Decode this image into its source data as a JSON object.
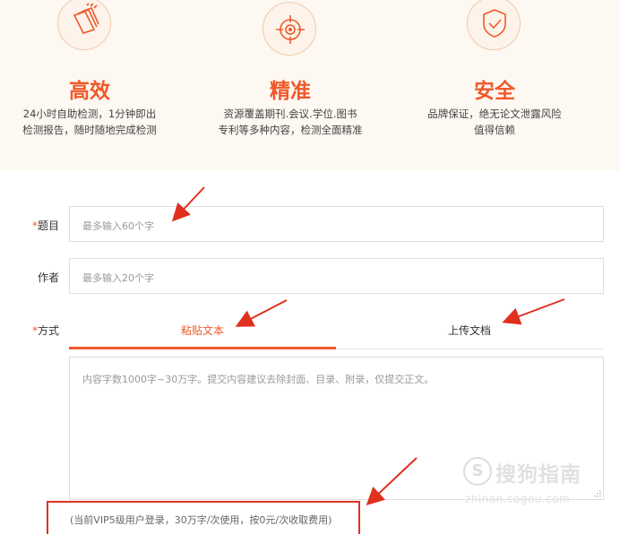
{
  "features": [
    {
      "icon": "document-stack-icon",
      "title": "高效",
      "desc1": "24小时自助检测，1分钟即出",
      "desc2": "检测报告，随时随地完成检测"
    },
    {
      "icon": "crosshair-target-icon",
      "title": "精准",
      "desc1": "资源覆盖期刊.会议.学位.图书",
      "desc2": "专利等多种内容，检测全面精准"
    },
    {
      "icon": "shield-check-icon",
      "title": "安全",
      "desc1": "品牌保证，绝无论文泄露风险",
      "desc2": "值得信赖"
    }
  ],
  "form": {
    "title_field": {
      "required_mark": "*",
      "label": "题目",
      "placeholder": "最多输入60个字"
    },
    "author_field": {
      "label": "作者",
      "placeholder": "最多输入20个字"
    },
    "method_field": {
      "required_mark": "*",
      "label": "方式"
    },
    "tabs": [
      {
        "label": "粘贴文本",
        "active": true
      },
      {
        "label": "上传文档",
        "active": false
      }
    ],
    "content_placeholder": "内容字数1000字~30万字。提交内容建议去除封面、目录、附录，仅提交正文。",
    "notice": "(当前VIP5级用户登录，30万字/次使用，按0元/次收取费用)"
  },
  "watermark": {
    "text": "搜狗指南",
    "logo_letter": "S",
    "url": "zhinan.sogou.com"
  },
  "colors": {
    "accent": "#f0592a",
    "annotation": "#e0301e",
    "band": "#fdf8f1"
  }
}
